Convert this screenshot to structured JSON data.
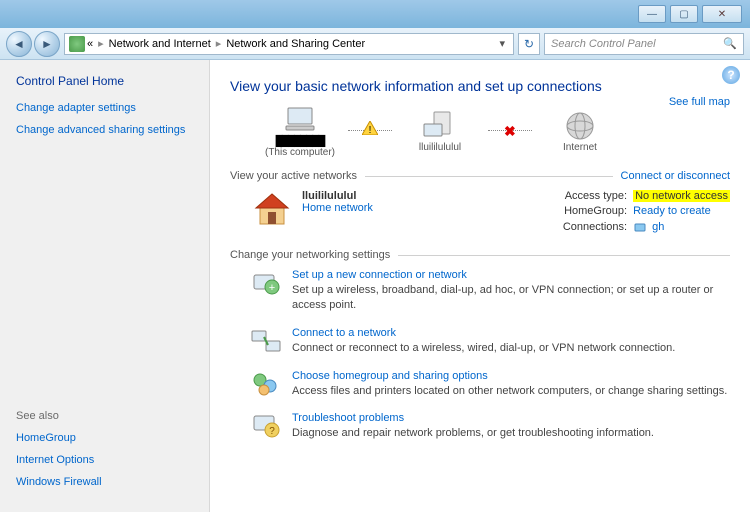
{
  "breadcrumb": {
    "level0": "«",
    "level1": "Network and Internet",
    "level2": "Network and Sharing Center"
  },
  "search": {
    "placeholder": "Search Control Panel"
  },
  "sidebar": {
    "home": "Control Panel Home",
    "links": [
      "Change adapter settings",
      "Change advanced sharing settings"
    ],
    "seealso_label": "See also",
    "seealso": [
      "HomeGroup",
      "Internet Options",
      "Windows Firewall"
    ]
  },
  "main": {
    "title": "View your basic network information and set up connections",
    "fullmap": "See full map",
    "netmap": {
      "node0": "(This computer)",
      "node1": "lluililululul",
      "node2": "Internet"
    },
    "active_section": "View your active networks",
    "connect_link": "Connect or disconnect",
    "network": {
      "name": "lluililululul",
      "type": "Home network",
      "access_label": "Access type:",
      "access_value": "No network access",
      "homegroup_label": "HomeGroup:",
      "homegroup_value": "Ready to create",
      "connections_label": "Connections:",
      "connections_value": "gh"
    },
    "change_section": "Change your networking settings",
    "settings": [
      {
        "title": "Set up a new connection or network",
        "desc": "Set up a wireless, broadband, dial-up, ad hoc, or VPN connection; or set up a router or access point."
      },
      {
        "title": "Connect to a network",
        "desc": "Connect or reconnect to a wireless, wired, dial-up, or VPN network connection."
      },
      {
        "title": "Choose homegroup and sharing options",
        "desc": "Access files and printers located on other network computers, or change sharing settings."
      },
      {
        "title": "Troubleshoot problems",
        "desc": "Diagnose and repair network problems, or get troubleshooting information."
      }
    ]
  }
}
